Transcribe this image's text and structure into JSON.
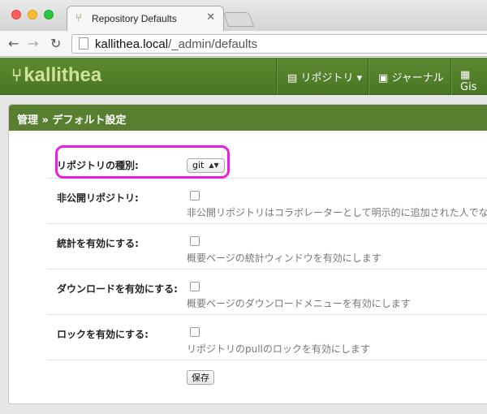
{
  "browser": {
    "tab_title": "Repository Defaults",
    "url_host": "kallithea.local",
    "url_path": "/_admin/defaults"
  },
  "app": {
    "logo": "kallithea",
    "nav": [
      "リポジトリ",
      "ジャーナル",
      "Gis"
    ]
  },
  "panel": {
    "title": "管理 » デフォルト設定",
    "fields": {
      "repo_type_label": "リポジトリの種別:",
      "repo_type_value": "git",
      "private_label": "非公開リポジトリ:",
      "private_help": "非公開リポジトリはコラボレーターとして明示的に追加された人でな",
      "stats_label": "統計を有効にする:",
      "stats_help": "概要ページの統計ウィンドウを有効にします",
      "download_label": "ダウンロードを有効にする:",
      "download_help": "概要ページのダウンロードメニューを有効にします",
      "lock_label": "ロックを有効にする:",
      "lock_help": "リポジトリのpullのロックを有効にします"
    },
    "save_label": "保存"
  },
  "colors": {
    "header_green": "#4a7624",
    "highlight": "#e81fe3"
  }
}
